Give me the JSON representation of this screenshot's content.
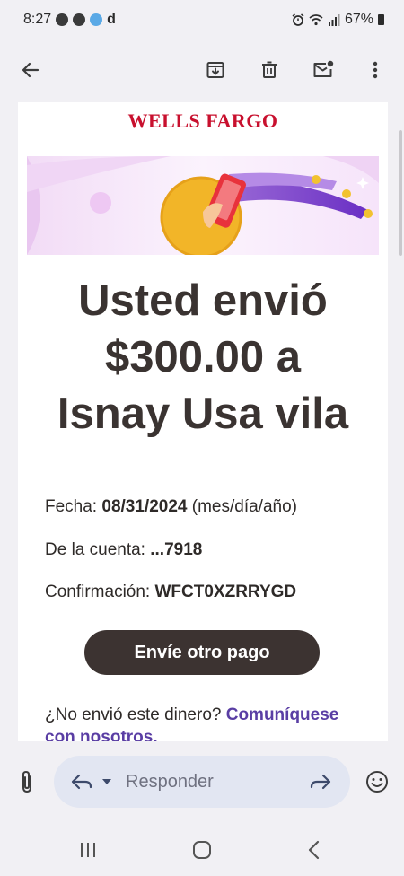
{
  "status_bar": {
    "time": "8:27",
    "extra_letter": "d",
    "battery": "67%"
  },
  "toolbar": {
    "back_icon": "arrow-left-icon",
    "archive_icon": "archive-icon",
    "delete_icon": "trash-icon",
    "unread_icon": "mark-unread-icon",
    "more_icon": "more-vertical-icon"
  },
  "email": {
    "brand": "WELLS FARGO",
    "headline_lines": [
      "Usted envió",
      "$300.00 a",
      "Isnay Usa vila"
    ],
    "date_label": "Fecha: ",
    "date_value": "08/31/2024",
    "date_format": " (mes/día/año)",
    "account_label": "De la cuenta: ",
    "account_value": "...7918",
    "confirmation_label": "Confirmación: ",
    "confirmation_value": "WFCT0XZRRYGD",
    "cta_label": "Envíe otro pago",
    "footer_question": "¿No envió este dinero? ",
    "footer_link": "Comuníquese con nosotros."
  },
  "reply_bar": {
    "placeholder": "Responder"
  },
  "colors": {
    "brand_red": "#c8102e",
    "cta_background": "#3c3331",
    "link_purple": "#5a3ea4",
    "reply_pill": "#e2e6f2"
  }
}
